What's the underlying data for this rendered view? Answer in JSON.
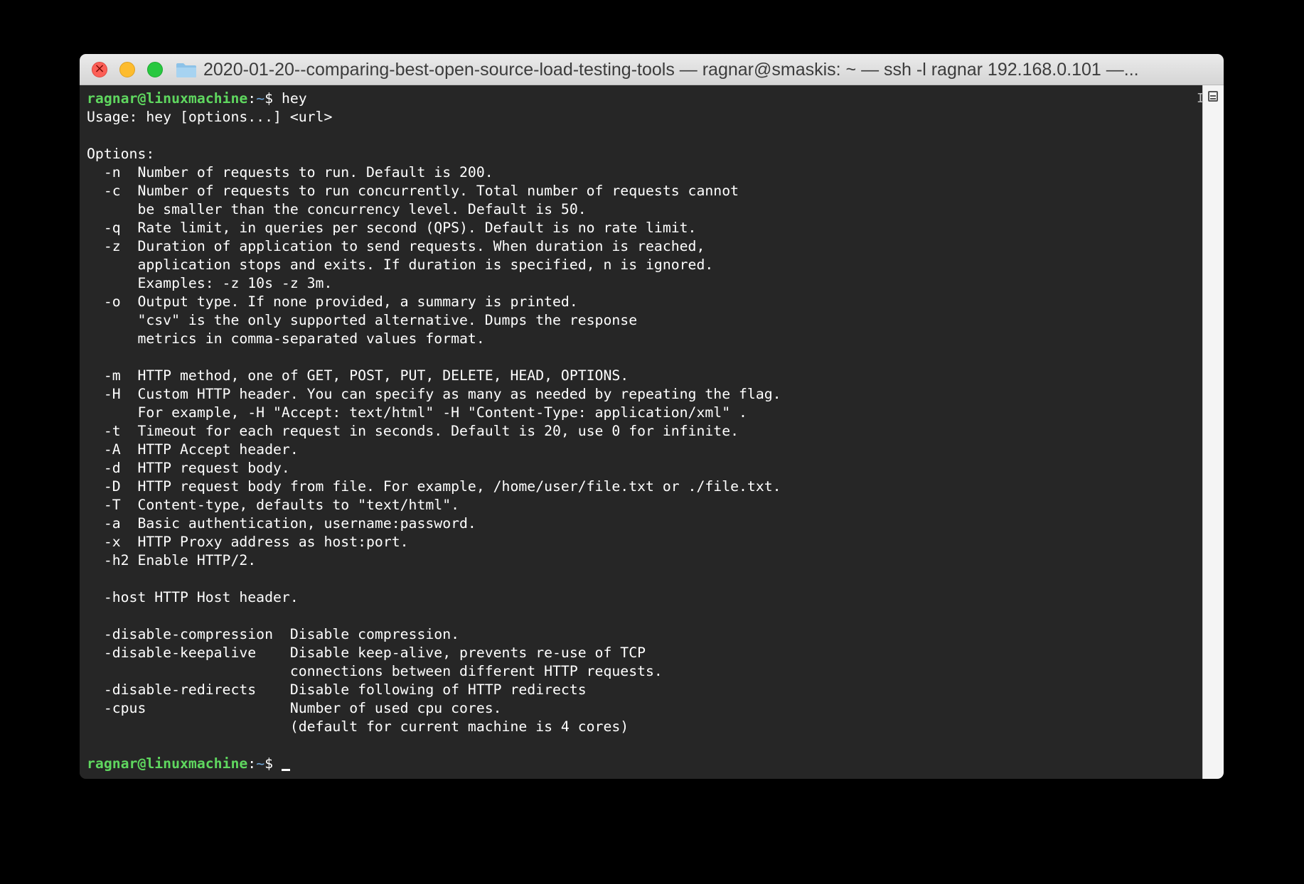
{
  "window": {
    "title": "2020-01-20--comparing-best-open-source-load-testing-tools — ragnar@smaskis: ~ — ssh -l ragnar 192.168.0.101 —..."
  },
  "icons": {
    "close": "close-icon",
    "minimize": "minimize-icon",
    "zoom": "zoom-icon",
    "folder": "folder-icon",
    "split_pane": "split-pane-icon"
  },
  "colors": {
    "terminal_bg": "#262626",
    "prompt_user": "#5fd75f",
    "prompt_path": "#6fa8dc",
    "text": "#ffffff"
  },
  "terminal": {
    "prompt_user_host": "ragnar@linuxmachine",
    "prompt_path": "~",
    "prompt_symbol": "$",
    "command": " hey",
    "output": [
      "Usage: hey [options...] <url>",
      "",
      "Options:",
      "  -n  Number of requests to run. Default is 200.",
      "  -c  Number of requests to run concurrently. Total number of requests cannot",
      "      be smaller than the concurrency level. Default is 50.",
      "  -q  Rate limit, in queries per second (QPS). Default is no rate limit.",
      "  -z  Duration of application to send requests. When duration is reached,",
      "      application stops and exits. If duration is specified, n is ignored.",
      "      Examples: -z 10s -z 3m.",
      "  -o  Output type. If none provided, a summary is printed.",
      "      \"csv\" is the only supported alternative. Dumps the response",
      "      metrics in comma-separated values format.",
      "",
      "  -m  HTTP method, one of GET, POST, PUT, DELETE, HEAD, OPTIONS.",
      "  -H  Custom HTTP header. You can specify as many as needed by repeating the flag.",
      "      For example, -H \"Accept: text/html\" -H \"Content-Type: application/xml\" .",
      "  -t  Timeout for each request in seconds. Default is 20, use 0 for infinite.",
      "  -A  HTTP Accept header.",
      "  -d  HTTP request body.",
      "  -D  HTTP request body from file. For example, /home/user/file.txt or ./file.txt.",
      "  -T  Content-type, defaults to \"text/html\".",
      "  -a  Basic authentication, username:password.",
      "  -x  HTTP Proxy address as host:port.",
      "  -h2 Enable HTTP/2.",
      "",
      "  -host HTTP Host header.",
      "",
      "  -disable-compression  Disable compression.",
      "  -disable-keepalive    Disable keep-alive, prevents re-use of TCP",
      "                        connections between different HTTP requests.",
      "  -disable-redirects    Disable following of HTTP redirects",
      "  -cpus                 Number of used cpu cores.",
      "                        (default for current machine is 4 cores)",
      ""
    ],
    "final_prompt_user_host": "ragnar@linuxmachine",
    "final_prompt_path": "~",
    "final_prompt_symbol": "$ "
  }
}
